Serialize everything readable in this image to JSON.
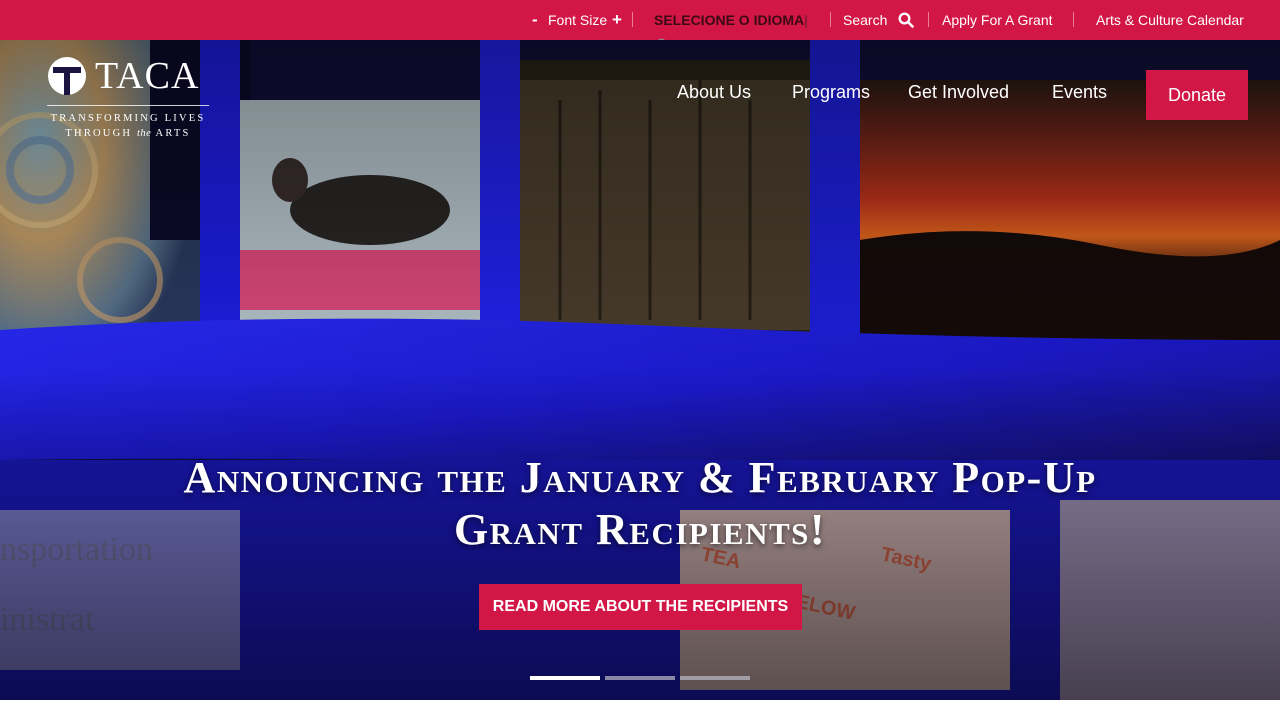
{
  "topbar": {
    "font_size_minus": "-",
    "font_size_label": "Font Size",
    "font_size_plus": "+",
    "language_select": "SELECIONE O IDIOMA",
    "search_label": "Search",
    "apply_grant": "Apply For A Grant",
    "calendar": "Arts & Culture Calendar",
    "background_color": "#d21645"
  },
  "logo": {
    "wordmark": "TACA",
    "tagline_line1": "TRANSFORMING LIVES",
    "tagline_line2_a": "THROUGH ",
    "tagline_line2_b": "the",
    "tagline_line2_c": " ARTS"
  },
  "nav": {
    "items": [
      "About Us",
      "Programs",
      "Get Involved",
      "Events"
    ],
    "donate": "Donate"
  },
  "hero": {
    "headline_line1": "Announcing the January & February Pop-Up",
    "headline_line2": "Grant Recipients!",
    "cta": "READ MORE ABOUT THE RECIPIENTS",
    "slides": 3,
    "active_slide": 1
  },
  "icons": {
    "search": "search-icon",
    "language_caret": "caret-down-icon",
    "logo_mark": "taca-logo-mark-icon"
  },
  "colors": {
    "accent": "#d21645",
    "text_on_dark": "#ffffff"
  }
}
